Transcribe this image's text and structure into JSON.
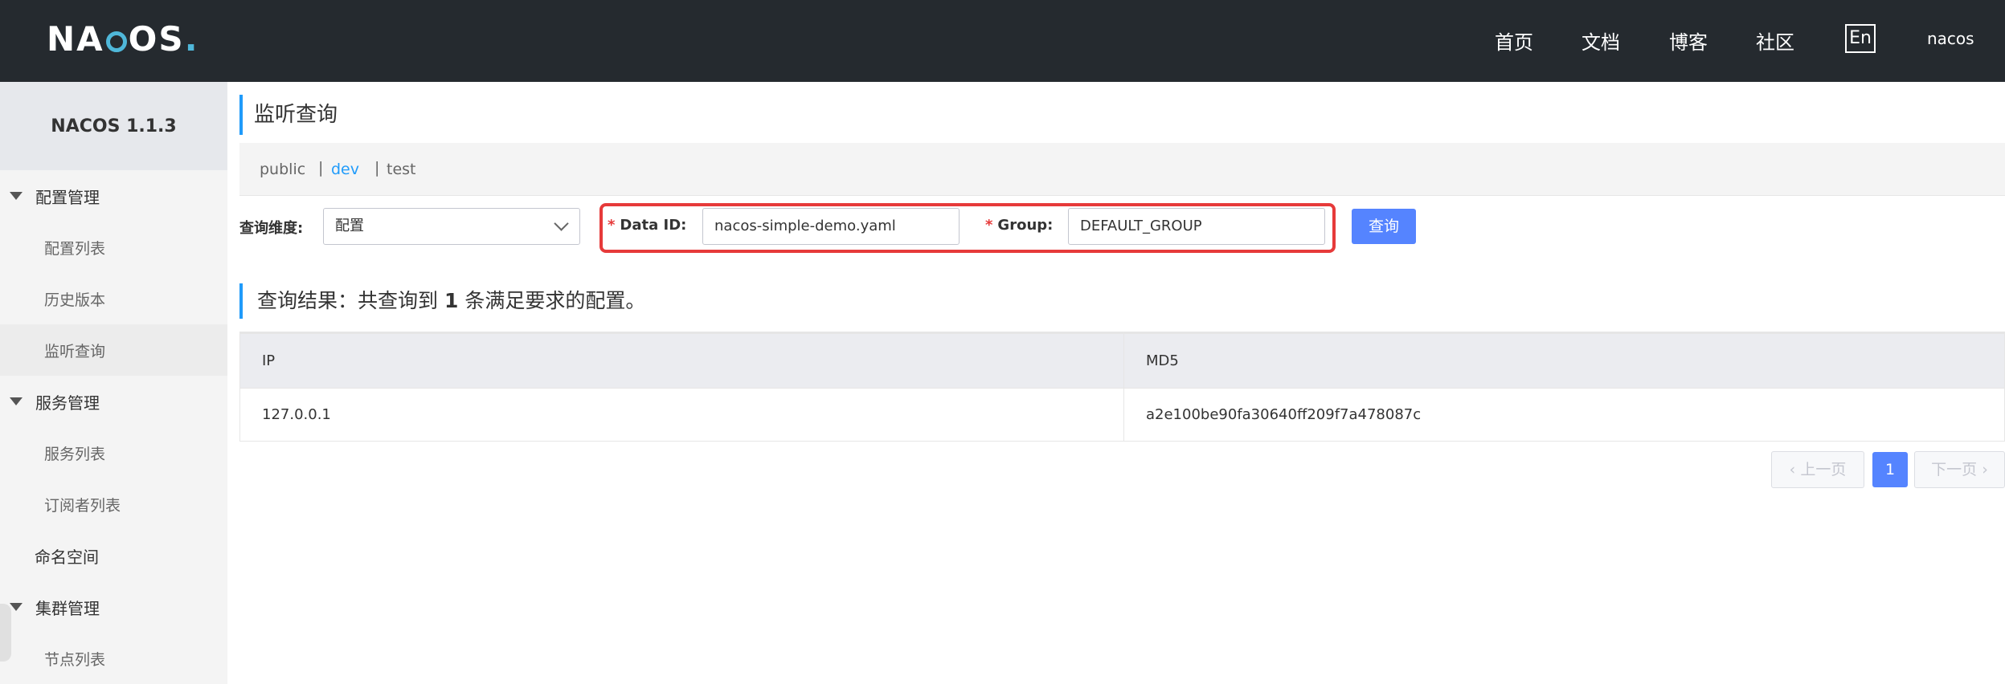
{
  "header": {
    "logo": "NACOS",
    "nav": [
      "首页",
      "文档",
      "博客",
      "社区"
    ],
    "lang": "En",
    "user": "nacos"
  },
  "sidebar": {
    "version": "NACOS 1.1.3",
    "groups": [
      {
        "label": "配置管理",
        "items": [
          "配置列表",
          "历史版本",
          "监听查询"
        ]
      },
      {
        "label": "服务管理",
        "items": [
          "服务列表",
          "订阅者列表"
        ]
      },
      {
        "label": "命名空间"
      },
      {
        "label": "集群管理",
        "items": [
          "节点列表"
        ]
      }
    ],
    "active_item": "监听查询"
  },
  "main": {
    "title": "监听查询",
    "namespaces": [
      "public",
      "dev",
      "test"
    ],
    "active_namespace": "dev",
    "query": {
      "dimension_label": "查询维度:",
      "dimension_value": "配置",
      "data_id_label": "Data ID:",
      "data_id_value": "nacos-simple-demo.yaml",
      "group_label": "Group:",
      "group_value": "DEFAULT_GROUP",
      "required_mark": "*",
      "button": "查询"
    },
    "result": {
      "prefix": "查询结果：共查询到",
      "count": "1",
      "suffix": "条满足要求的配置。"
    },
    "table": {
      "columns": [
        "IP",
        "MD5"
      ],
      "rows": [
        [
          "127.0.0.1",
          "a2e100be90fa30640ff209f7a478087c"
        ]
      ]
    },
    "pagination": {
      "prev": "上一页",
      "current": "1",
      "next": "下一页"
    }
  },
  "colors": {
    "header_bg": "#252a2f",
    "accent": "#209bfa",
    "button": "#5584ff",
    "highlight_box": "#e63a3a"
  }
}
